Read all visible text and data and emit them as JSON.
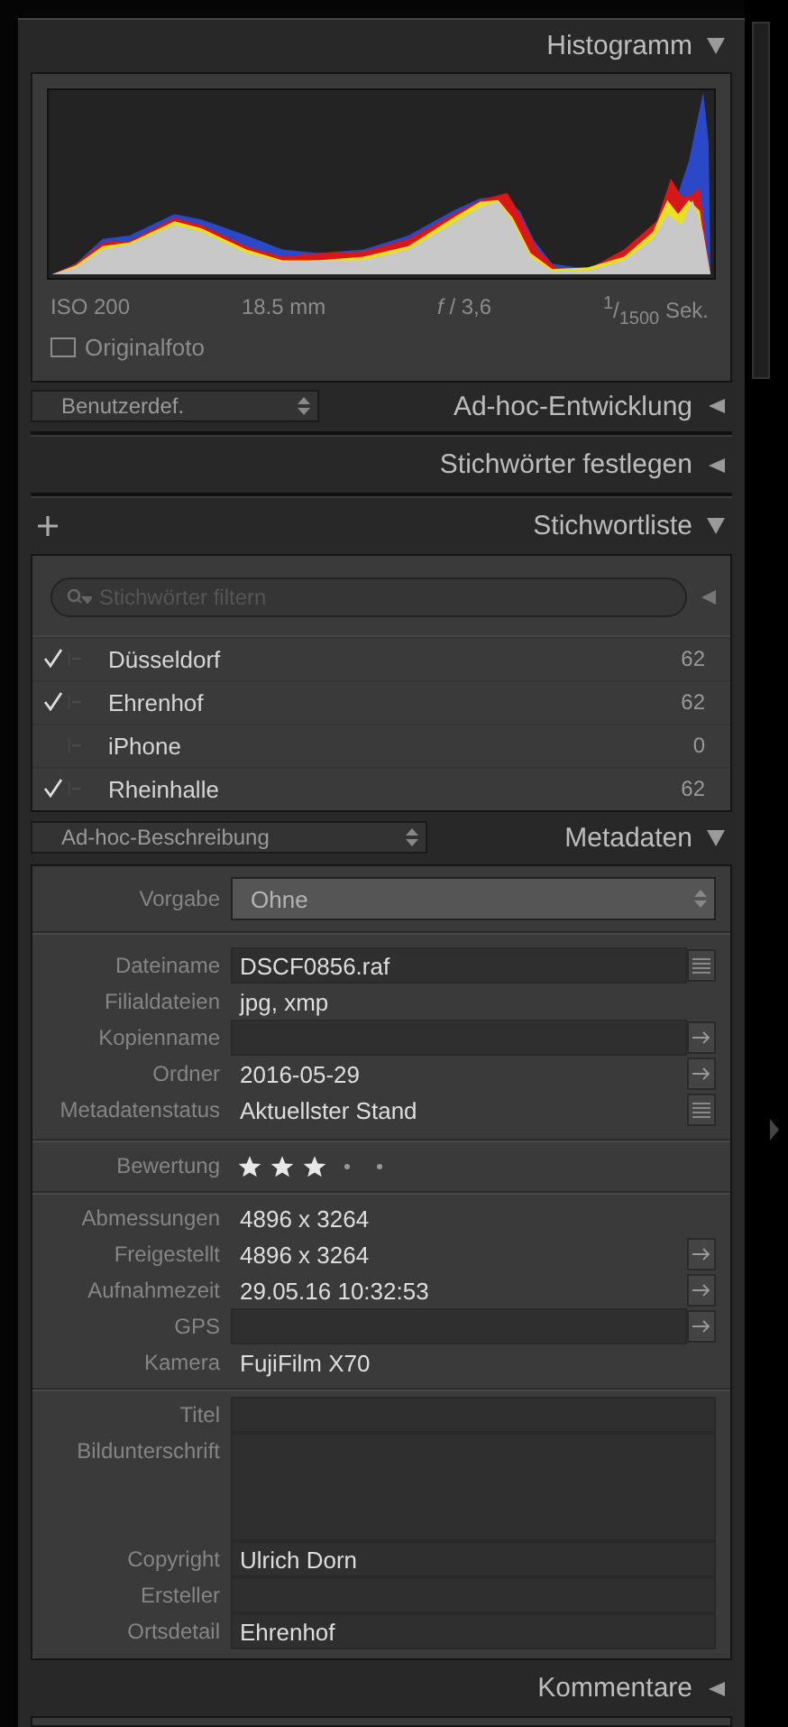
{
  "histogram": {
    "header": {
      "title": "Histogramm",
      "expanded": true
    },
    "exif": [
      "ISO 200",
      "18.5 mm",
      "*f* / 3,6",
      "$^{1}$/$_{1500}$ Sek."
    ],
    "original_photo": {
      "label": "Originalfoto",
      "checked": false
    }
  },
  "develop": {
    "preset": "Benutzerdef.",
    "header": {
      "title": "Ad-hoc-Entwicklung",
      "expanded": false
    }
  },
  "keywording": {
    "header": {
      "title": "Stichwörter festlegen",
      "expanded": false
    }
  },
  "keyword_list": {
    "header": {
      "title": "Stichwortliste",
      "expanded": true
    },
    "filter": {
      "placeholder": "Stichwörter filtern"
    },
    "keywords": [
      {
        "name": "Düsseldorf",
        "checked": true,
        "count": "62"
      },
      {
        "name": "Ehrenhof",
        "checked": true,
        "count": "62"
      },
      {
        "name": "iPhone",
        "checked": false,
        "count": "0"
      },
      {
        "name": "Rheinhalle",
        "checked": true,
        "count": "62"
      }
    ]
  },
  "metadata": {
    "preset": "Ad-hoc-Beschreibung",
    "header": {
      "title": "Metadaten",
      "expanded": true
    },
    "groups": [
      {
        "rows": [
          {
            "label": "Vorgabe",
            "kind": "select",
            "value": "Ohne"
          }
        ]
      },
      {
        "rows": [
          {
            "label": "Dateiname",
            "kind": "field",
            "value": "DSCF0856.raf",
            "list_button": true
          },
          {
            "label": "Filialdateien",
            "kind": "text",
            "value": "jpg, xmp"
          },
          {
            "label": "Kopienname",
            "kind": "field",
            "arrow_button": true
          },
          {
            "label": "Ordner",
            "kind": "text",
            "value": "2016-05-29",
            "arrow_button": true
          },
          {
            "label": "Metadatenstatus",
            "kind": "text",
            "value": "Aktuellster Stand",
            "list_button": true
          }
        ]
      },
      {
        "rows": [
          {
            "label": "Bewertung",
            "kind": "stars",
            "stars": 3
          }
        ]
      },
      {
        "rows": [
          {
            "label": "Abmessungen",
            "kind": "text",
            "value": "4896 x 3264"
          },
          {
            "label": "Freigestellt",
            "kind": "text",
            "value": "4896 x 3264",
            "arrow_button": true
          },
          {
            "label": "Aufnahmezeit",
            "kind": "text",
            "value": "29.05.16 10:32:53",
            "arrow_button": true
          },
          {
            "label": "GPS",
            "kind": "field",
            "arrow_button": true
          },
          {
            "label": "Kamera",
            "kind": "text",
            "value": "FujiFilm X70"
          }
        ]
      },
      {
        "rows": [
          {
            "label": "Titel",
            "kind": "field"
          },
          {
            "label": "Bildunterschrift",
            "kind": "area"
          },
          {
            "label": "Copyright",
            "kind": "field",
            "value": "Ulrich Dorn"
          },
          {
            "label": "Ersteller",
            "kind": "field"
          },
          {
            "label": "Ortsdetail",
            "kind": "field",
            "value": "Ehrenhof"
          }
        ]
      }
    ]
  },
  "comments": {
    "header": {
      "title": "Kommentare",
      "expanded": false
    }
  }
}
